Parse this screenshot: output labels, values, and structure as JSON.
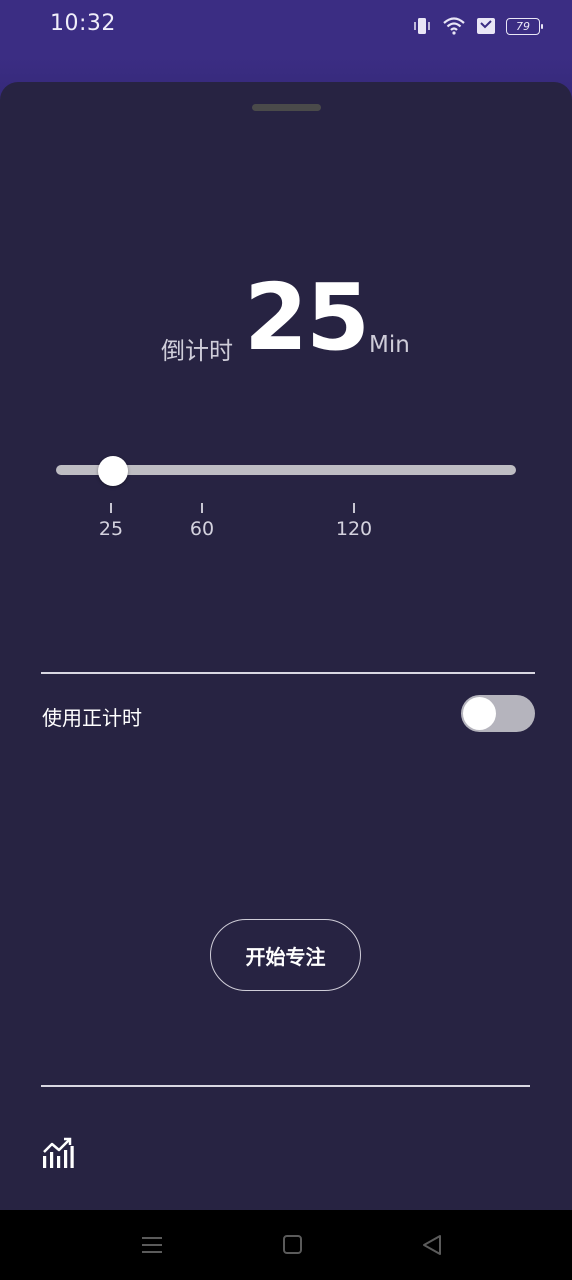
{
  "status_bar": {
    "time": "10:32",
    "battery": "79",
    "icons": [
      "vibrate-icon",
      "wifi-icon",
      "notification-icon",
      "battery-icon"
    ]
  },
  "timer": {
    "label": "倒计时",
    "value": "25",
    "unit": "Min"
  },
  "slider": {
    "current_value": 25,
    "ticks": [
      "25",
      "60",
      "120"
    ]
  },
  "toggle": {
    "label": "使用正计时",
    "on": false
  },
  "actions": {
    "start_label": "开始专注"
  },
  "footer": {
    "icons": [
      "stats-chart-icon"
    ]
  },
  "nav_bar": {
    "icons": [
      "menu-icon",
      "home-icon",
      "back-icon"
    ]
  },
  "colors": {
    "header_purple": "#3b2d83",
    "sheet_background": "#272342",
    "track": "#bebdc3",
    "text_primary": "#ffffff"
  }
}
